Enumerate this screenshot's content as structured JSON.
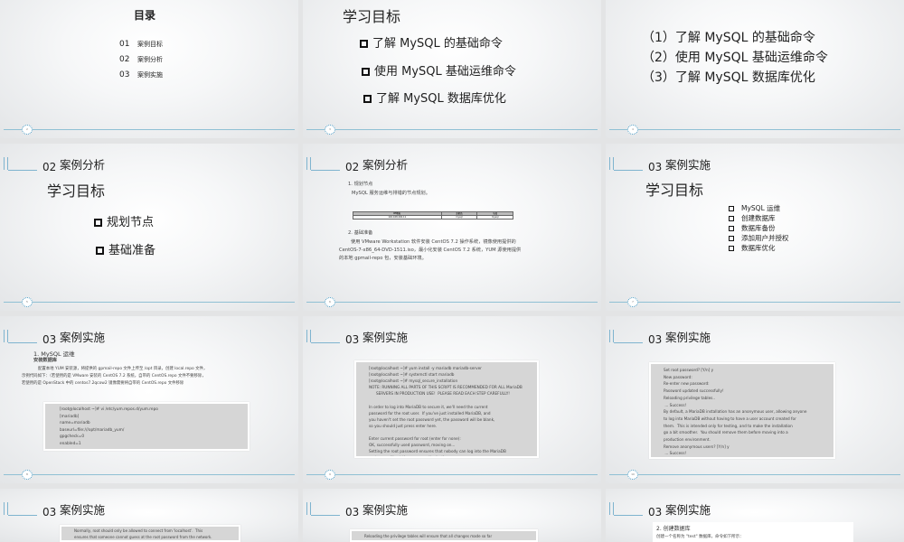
{
  "slides": [
    {
      "page": "2",
      "title": "目录",
      "items": [
        {
          "num": "01",
          "label": "案例目标"
        },
        {
          "num": "02",
          "label": "案例分析"
        },
        {
          "num": "03",
          "label": "案例实施"
        }
      ]
    },
    {
      "page": "3",
      "title": "学习目标",
      "bullets": [
        "了解 MySQL 的基础命令",
        "使用 MySQL 基础运维命令",
        "了解 MySQL 数据库优化"
      ]
    },
    {
      "page": "4",
      "lines": [
        "（1）了解 MySQL 的基础命令",
        "（2）使用 MySQL 基础运维命令",
        "（3）了解 MySQL 数据库优化"
      ]
    },
    {
      "page": "5",
      "num": "02",
      "section": "案例分析",
      "title": "学习目标",
      "bullets": [
        "规划节点",
        "基础准备"
      ]
    },
    {
      "page": "6",
      "num": "02",
      "section": "案例分析",
      "h1": "1. 规划节点",
      "p1": "MySQL 服务运维与排错的节点规划。",
      "table": {
        "headers": [
          "IP地址",
          "主机名",
          "节点"
        ],
        "row": [
          "192.168.200.11",
          "mysql",
          "mysql"
        ]
      },
      "h2": "2. 基础准备",
      "p2": [
        "使用 VMware Workstation 软件安装 CentOS 7.2 操作系统，镜像使用提供的",
        "CentOS-7-x86_64-DVD-1511.iso，最小化安装 CentOS 7.2 系统，YUM 源使用提供",
        "的本地 gpmail-repo 包，安装基础环境。"
      ]
    },
    {
      "page": "7",
      "num": "03",
      "section": "案例实施",
      "title": "学习目标",
      "items": [
        "MySQL 运维",
        "创建数据库",
        "数据库备份",
        "添加用户并授权",
        "数据库优化"
      ]
    },
    {
      "page": "8",
      "num": "03",
      "section": "案例实施",
      "h1": "1. MySQL 运维",
      "h2": "安装数据库",
      "p": [
        "配置本地 YUM 安装源，将提供的 gpmail-repo 文件上传至 /opt 目录，创建 local.repo 文件，",
        "示例代码如下：（若使用的是 VMware 安装的 CentOS 7.2 系统，自带的 CentOS.repo 文件不要移除，",
        "若使用的是 OpenStack 中的 centos7.2qcow2 镜像需要将自带的 CentOS.repo 文件移除"
      ],
      "code": "[root@localhost ~]# vi /etc/yum.repos.d/yum.repo\n[mariadb]\nname=mariadb\nbaseurl=file:///opt/mariadb_yum/\ngpgcheck=0\nenabled=1"
    },
    {
      "page": "9",
      "num": "03",
      "section": "案例实施",
      "code": "[root@localhost ~]# yum install -y mariadb mariadb-server\n[root@localhost ~]# systemctl start mariadb\n[root@localhost ~]# mysql_secure_installation\nNOTE: RUNNING ALL PARTS OF THIS SCRIPT IS RECOMMENDED FOR ALL MariaDB\n      SERVERS IN PRODUCTION USE!  PLEASE READ EACH STEP CAREFULLY!\n\nIn order to log into MariaDB to secure it, we'll need the current\npassword for the root user.  If you've just installed MariaDB, and\nyou haven't set the root password yet, the password will be blank,\nso you should just press enter here.\n\nEnter current password for root (enter for none):\nOK, successfully used password, moving on...\nSetting the root password ensures that nobody can log into the MariaDB\nroot user without the proper authorisation."
    },
    {
      "page": "10",
      "num": "03",
      "section": "案例实施",
      "code": "Set root password? [Y/n] y\nNew password:\nRe-enter new password:\nPassword updated successfully!\nReloading privilege tables..\n ... Success!\nBy default, a MariaDB installation has an anonymous user, allowing anyone\nto log into MariaDB without having to have a user account created for\nthem.  This is intended only for testing, and to make the installation\ngo a bit smoother.  You should remove them before moving into a\nproduction environment.\nRemove anonymous users? [Y/n] y\n ... Success!"
    },
    {
      "num": "03",
      "section": "案例实施",
      "code": "Normally, root should only be allowed to connect from 'localhost'.  This\nensures that someone cannot guess at the root password from the network."
    },
    {
      "num": "03",
      "section": "案例实施",
      "code": "Reloading the privilege tables will ensure that all changes made so far"
    },
    {
      "num": "03",
      "section": "案例实施",
      "h1": "2. 创建数据库",
      "p": "创建一个名称为 \"test\" 数据库，命令如下所示："
    }
  ]
}
